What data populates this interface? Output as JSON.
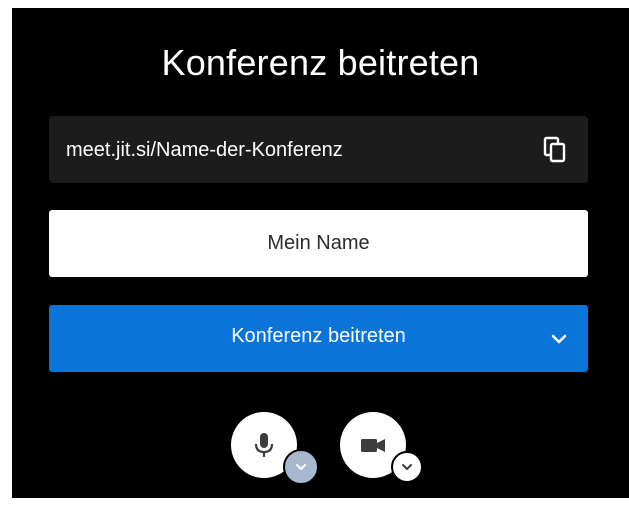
{
  "dialog": {
    "title": "Konferenz beitreten"
  },
  "meeting_url": {
    "value": "meet.jit.si/Name-der-Konferenz",
    "copy_icon": "copy-icon"
  },
  "name_field": {
    "placeholder": "Mein Name",
    "value": ""
  },
  "join_button": {
    "label": "Konferenz beitreten",
    "options_icon": "chevron-down-icon",
    "color": "#0a74d9"
  },
  "media_controls": {
    "microphone": {
      "icon": "microphone-icon",
      "options_icon": "chevron-down-icon",
      "badge_color": "#a7b8cf"
    },
    "camera": {
      "icon": "video-camera-icon",
      "options_icon": "chevron-down-icon",
      "badge_color": "#ffffff"
    }
  }
}
